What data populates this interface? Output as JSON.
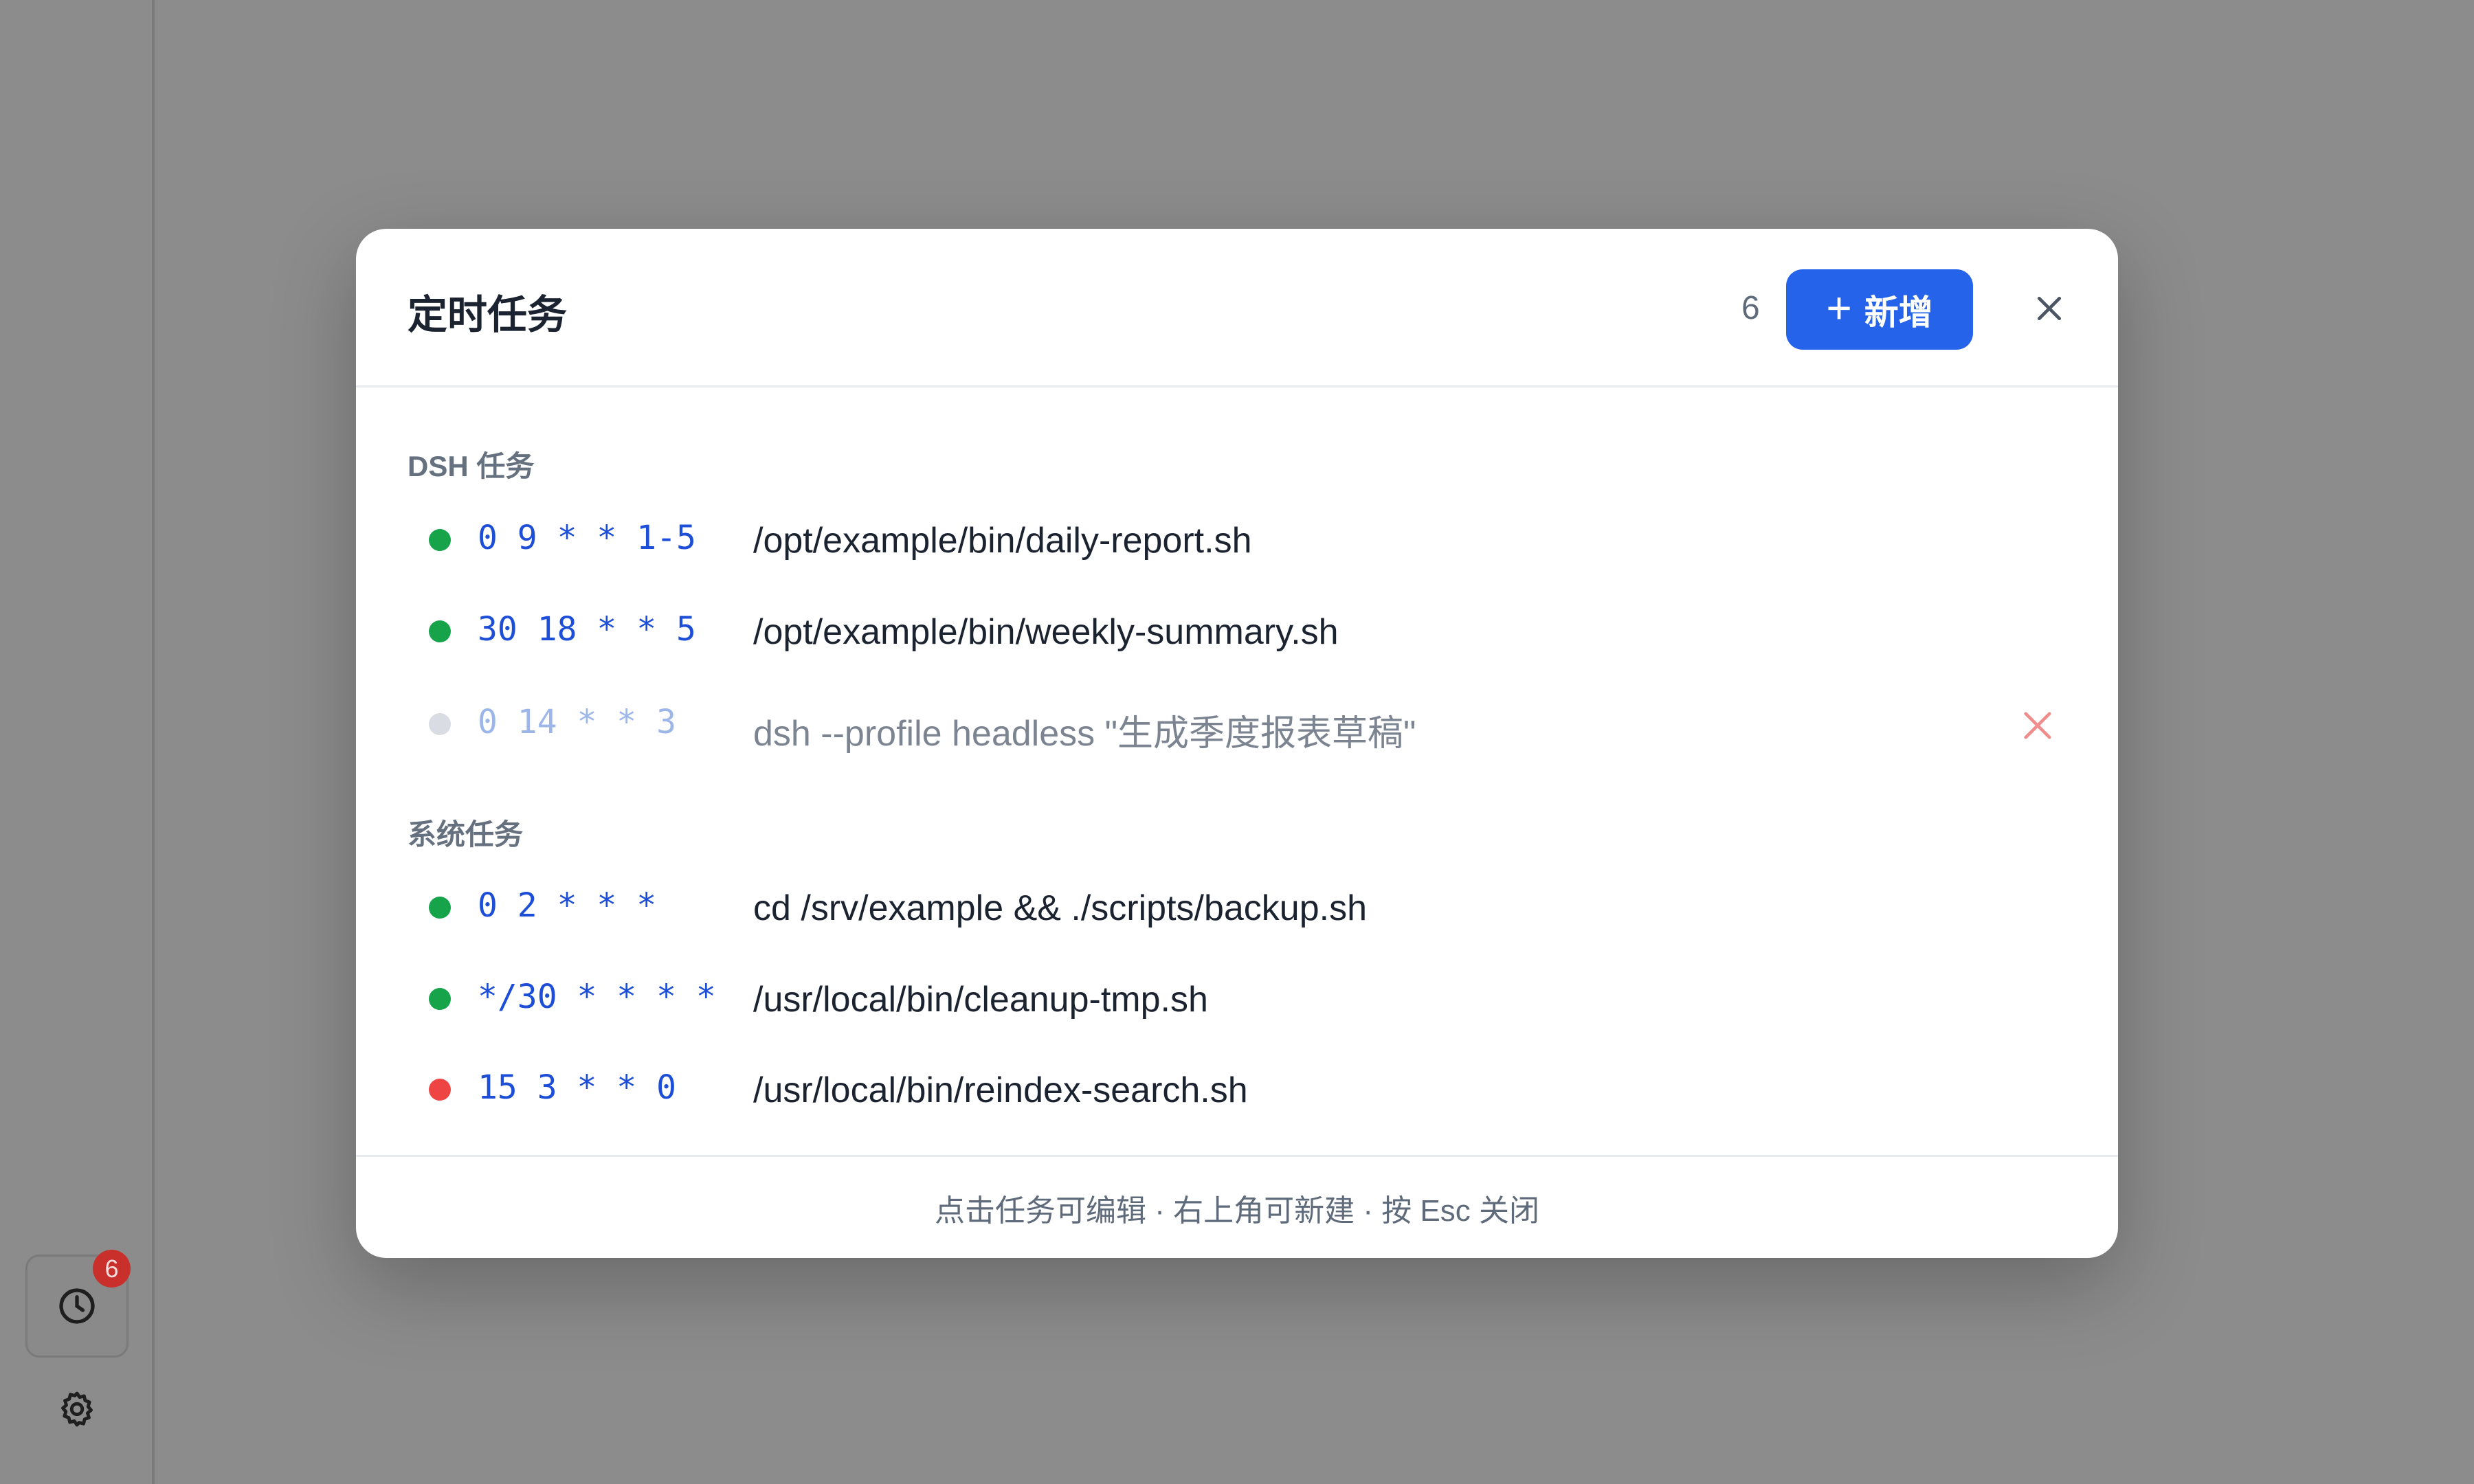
{
  "sidebar": {
    "badge_count": "6",
    "icons": {
      "clock": "clock-icon",
      "settings": "gear-icon"
    }
  },
  "modal": {
    "title": "定时任务",
    "count": "6",
    "add_label": "新增",
    "sections": [
      {
        "label": "DSH 任务",
        "items": [
          {
            "cron": "0 9 * * 1-5",
            "command": "/opt/example/bin/daily-report.sh",
            "status": "active"
          },
          {
            "cron": "30 18 * * 5",
            "command": "/opt/example/bin/weekly-summary.sh",
            "status": "active"
          },
          {
            "cron": "0 14 * * 3",
            "command": "dsh --profile headless \"生成季度报表草稿\"",
            "status": "disabled"
          }
        ]
      },
      {
        "label": "系统任务",
        "items": [
          {
            "cron": "0 2 * * *",
            "command": "cd /srv/example && ./scripts/backup.sh",
            "status": "active"
          },
          {
            "cron": "*/30 * * * *",
            "command": "/usr/local/bin/cleanup-tmp.sh",
            "status": "active"
          },
          {
            "cron": "15 3 * * 0",
            "command": "/usr/local/bin/reindex-search.sh",
            "status": "error"
          }
        ]
      }
    ],
    "footer": "点击任务可编辑 · 右上角可新建 · 按 Esc 关闭"
  },
  "colors": {
    "accent": "#2563eb",
    "status_active": "#16a34a",
    "status_disabled": "#d9dde3",
    "status_error": "#ef4444",
    "delete_icon": "#f08c8c"
  }
}
